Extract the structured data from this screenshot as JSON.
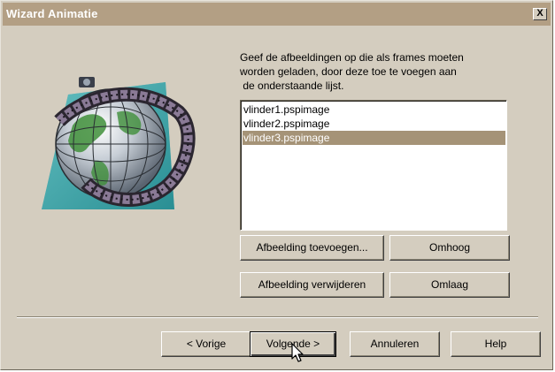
{
  "window": {
    "title": "Wizard Animatie",
    "close_glyph": "X"
  },
  "illustration": {
    "icon": "globe-with-filmstrip-icon"
  },
  "instructions": {
    "line1": "Geef de afbeeldingen op die als frames moeten",
    "line2": "worden geladen, door deze toe te voegen aan",
    "line3": " de onderstaande lijst."
  },
  "file_list": {
    "items": [
      {
        "label": "vlinder1.pspimage",
        "selected": false
      },
      {
        "label": "vlinder2.pspimage",
        "selected": false
      },
      {
        "label": "vlinder3.pspimage",
        "selected": true
      }
    ]
  },
  "buttons": {
    "add_image": "Afbeelding toevoegen...",
    "move_up": "Omhoog",
    "remove_image": "Afbeelding verwijderen",
    "move_down": "Omlaag",
    "previous": "< Vorige",
    "next": "Volgende >",
    "cancel": "Annuleren",
    "help": "Help"
  },
  "colors": {
    "titlebar": "#b39f84",
    "dialog_bg": "#d4cdbf",
    "selection": "#a59377"
  }
}
